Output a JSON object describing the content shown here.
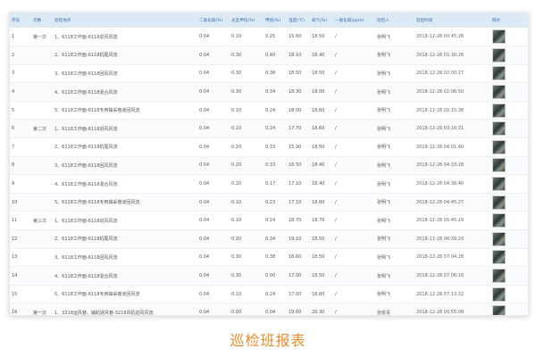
{
  "caption": "巡检班报表",
  "headers": [
    "序号",
    "次数",
    "巡检地点",
    "二氧化碳(%)",
    "光瓦甲烷(%)",
    "甲烷(%)",
    "温度(℃)",
    "氧气(%)",
    "一氧化碳(ppm)",
    "巡检人",
    "巡检时间",
    "照片"
  ],
  "rows": [
    {
      "no": "1",
      "round": "第一次",
      "location": "1、6118工作面-6118进风风流",
      "co2": "0.04",
      "ch4_opt": "0.10",
      "ch4": "0.25",
      "temp": "15.60",
      "o2": "18.50",
      "co": "/",
      "inspector": "张明飞",
      "time": "2018-12-28 00:45:26"
    },
    {
      "no": "2",
      "round": "",
      "location": "2、6118工作面-6118机尾风流",
      "co2": "0.04",
      "ch4_opt": "0.30",
      "ch4": "0.40",
      "temp": "18.10",
      "o2": "18.40",
      "co": "/",
      "inspector": "张明飞",
      "time": "2018-12-28 01:30:26"
    },
    {
      "no": "3",
      "round": "",
      "location": "3、6118工作面-6118回风风流",
      "co2": "0.04",
      "ch4_opt": "0.30",
      "ch4": "0.38",
      "temp": "18.50",
      "o2": "18.50",
      "co": "/",
      "inspector": "张明飞",
      "time": "2018-12-28 02:00:27"
    },
    {
      "no": "4",
      "round": "",
      "location": "4、6118工作面-6118混合风流",
      "co2": "0.04",
      "ch4_opt": "0.30",
      "ch4": "0.34",
      "temp": "18.30",
      "o2": "18.00",
      "co": "/",
      "inspector": "张明飞",
      "time": "2018-12-28 02:06:50"
    },
    {
      "no": "5",
      "round": "",
      "location": "5、6118工作面-6118专用抽采巷道回风流",
      "co2": "0.04",
      "ch4_opt": "0.10",
      "ch4": "0.24",
      "temp": "18.00",
      "o2": "18.60",
      "co": "/",
      "inspector": "张明飞",
      "time": "2018-12-28 02:15:38"
    },
    {
      "no": "6",
      "round": "第二次",
      "location": "1、6118工作面-6118进风风流",
      "co2": "0.04",
      "ch4_opt": "0.10",
      "ch4": "0.24",
      "temp": "17.70",
      "o2": "18.60",
      "co": "/",
      "inspector": "张明飞",
      "time": "2018-12-28 03:16:31"
    },
    {
      "no": "7",
      "round": "",
      "location": "2、6118工作面-6118机尾风流",
      "co2": "0.04",
      "ch4_opt": "0.20",
      "ch4": "0.33",
      "temp": "15.90",
      "o2": "18.50",
      "co": "/",
      "inspector": "张明飞",
      "time": "2018-12-28 04:01:40"
    },
    {
      "no": "8",
      "round": "",
      "location": "3、6118工作面-6118回风风流",
      "co2": "0.04",
      "ch4_opt": "0.20",
      "ch4": "0.33",
      "temp": "16.50",
      "o2": "18.40",
      "co": "/",
      "inspector": "张明飞",
      "time": "2018-12-28 04:33:28"
    },
    {
      "no": "9",
      "round": "",
      "location": "4、6118工作面-6118混合风流",
      "co2": "0.04",
      "ch4_opt": "0.20",
      "ch4": "0.17",
      "temp": "17.10",
      "o2": "18.40",
      "co": "/",
      "inspector": "张明飞",
      "time": "2018-12-28 04:36:40"
    },
    {
      "no": "10",
      "round": "",
      "location": "5、6118工作面-6118专用抽采巷道回风流",
      "co2": "0.04",
      "ch4_opt": "0.10",
      "ch4": "0.23",
      "temp": "17.10",
      "o2": "18.60",
      "co": "/",
      "inspector": "张明飞",
      "time": "2018-12-28 04:45:27"
    },
    {
      "no": "11",
      "round": "第三次",
      "location": "1、6118工作面-6118进风风流",
      "co2": "0.04",
      "ch4_opt": "0.10",
      "ch4": "0.24",
      "temp": "18.70",
      "o2": "18.70",
      "co": "/",
      "inspector": "张明飞",
      "time": "2018-12-28 05:45:29"
    },
    {
      "no": "12",
      "round": "",
      "location": "2、6118工作面-6118机尾风流",
      "co2": "0.04",
      "ch4_opt": "0.20",
      "ch4": "0.34",
      "temp": "19.10",
      "o2": "18.50",
      "co": "/",
      "inspector": "张明飞",
      "time": "2018-12-28 06:39:29"
    },
    {
      "no": "13",
      "round": "",
      "location": "3、6118工作面-6118回风风流",
      "co2": "0.04",
      "ch4_opt": "0.30",
      "ch4": "0.38",
      "temp": "16.60",
      "o2": "18.50",
      "co": "/",
      "inspector": "张明飞",
      "time": "2018-12-28 07:04:28"
    },
    {
      "no": "14",
      "round": "",
      "location": "4、6118工作面-6118混合风流",
      "co2": "0.04",
      "ch4_opt": "0.30",
      "ch4": "0.00",
      "temp": "17.00",
      "o2": "18.50",
      "co": "/",
      "inspector": "张明飞",
      "time": "2018-12-28 07:06:18"
    },
    {
      "no": "15",
      "round": "",
      "location": "5、6118工作面-6118专用抽采巷道回风流",
      "co2": "0.04",
      "ch4_opt": "0.10",
      "ch4": "0.24",
      "temp": "17.00",
      "o2": "18.60",
      "co": "/",
      "inspector": "张明飞",
      "time": "2018-12-28 07:13:32"
    },
    {
      "no": "16",
      "round": "第一次",
      "location": "1、3218运风巷、辅助进风巷-3218风机进风风流",
      "co2": "0.04",
      "ch4_opt": "0.00",
      "ch4": "0.04",
      "temp": "19.60",
      "o2": "20.30",
      "co": "/",
      "inspector": "张俊青",
      "time": "2018-12-28 00:55:08"
    }
  ]
}
